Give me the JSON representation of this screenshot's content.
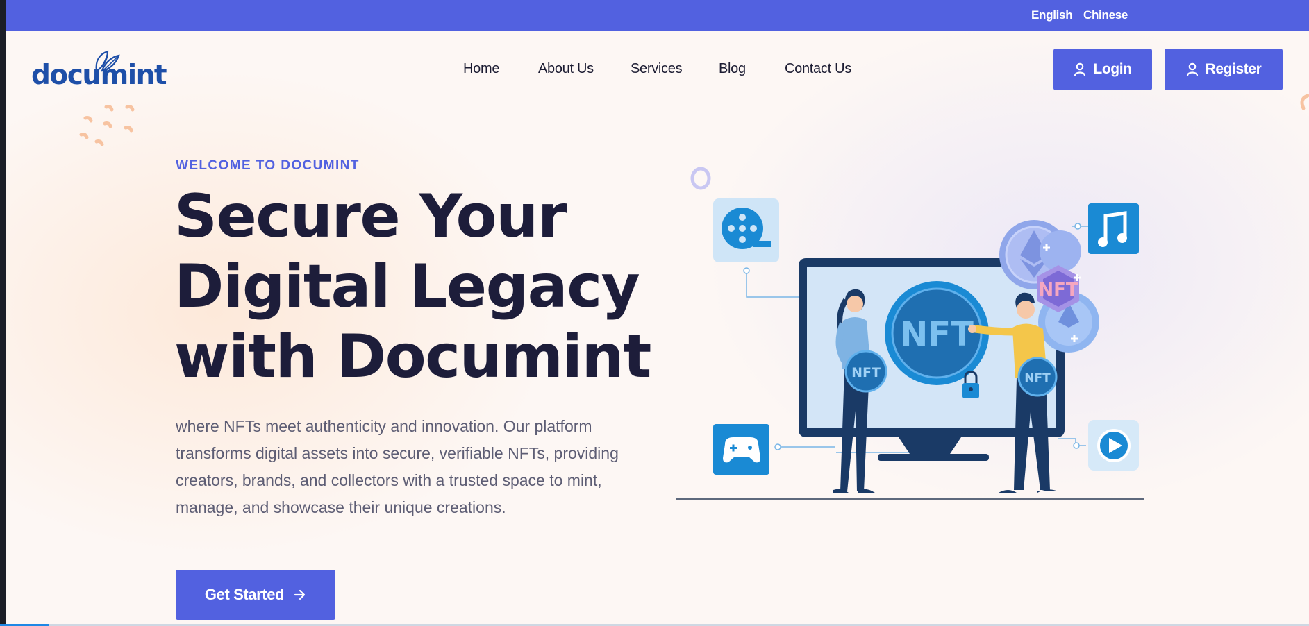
{
  "topbar": {
    "languages": [
      "English",
      "Chinese"
    ]
  },
  "brand": {
    "logo_text": "documint",
    "color": "#1e4fa8"
  },
  "nav": {
    "items": [
      "Home",
      "About Us",
      "Services",
      "Blog",
      "Contact Us"
    ]
  },
  "auth": {
    "login_label": "Login",
    "register_label": "Register"
  },
  "hero": {
    "eyebrow": "WELCOME TO DOCUMINT",
    "title_line1": "Secure Your",
    "title_line2": "Digital Legacy",
    "title_line3": "with Documint",
    "description": "where NFTs meet authenticity and innovation. Our platform transforms digital assets into secure, verifiable NFTs, providing creators, brands, and collectors with a trusted space to mint, manage, and showcase their unique creations.",
    "cta_label": "Get Started"
  },
  "illustration": {
    "nft_label": "NFT",
    "icons": [
      "film-reel-icon",
      "music-note-icon",
      "gamepad-icon",
      "play-icon",
      "padlock-icon",
      "ethereum-coin-icon"
    ]
  },
  "colors": {
    "accent": "#5261e0",
    "heading": "#1d1d3a",
    "body_text": "#5d5d74",
    "illustration_blue": "#1a8ad4",
    "illustration_navy": "#1a3a66"
  }
}
